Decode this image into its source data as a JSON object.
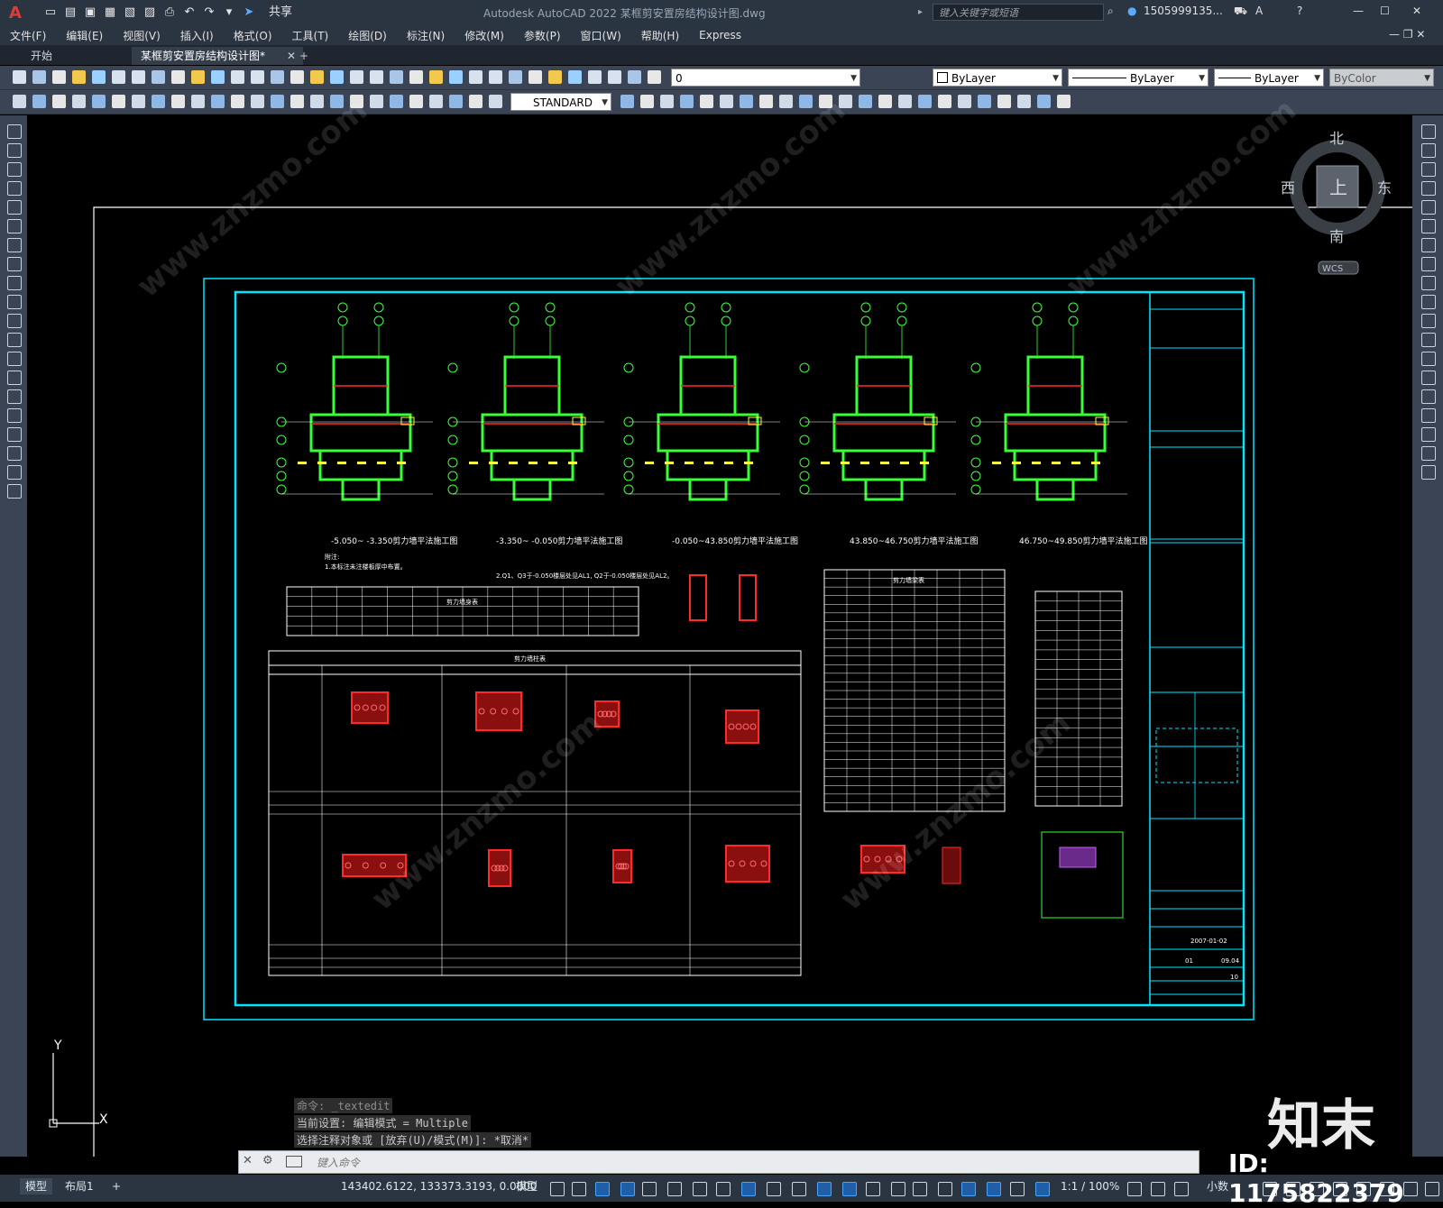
{
  "app": {
    "title_text": "Autodesk AutoCAD 2022    某框剪安置房结构设计图.dwg",
    "logo": "A",
    "share_label": "共享",
    "search_placeholder": "键入关键字或短语",
    "user": "1505999135...",
    "window_controls": [
      "—",
      "☐",
      "✕"
    ]
  },
  "menu": [
    "文件(F)",
    "编辑(E)",
    "视图(V)",
    "插入(I)",
    "格式(O)",
    "工具(T)",
    "绘图(D)",
    "标注(N)",
    "修改(M)",
    "参数(P)",
    "窗口(W)",
    "帮助(H)",
    "Express"
  ],
  "tabs": [
    {
      "label": "开始",
      "active": false
    },
    {
      "label": "某框剪安置房结构设计图*",
      "active": true
    }
  ],
  "toolbar": {
    "layer_value": "0",
    "color_value": "ByLayer",
    "linetype_value": "ByLayer",
    "lineweight_value": "ByLayer",
    "plotstyle_value": "ByColor",
    "textstyle_value": "STANDARD"
  },
  "viewcube": {
    "north": "北",
    "south": "南",
    "east": "东",
    "west": "西",
    "face": "上",
    "wcs": "WCS"
  },
  "ucs": {
    "y": "Y",
    "x": "X"
  },
  "drawing": {
    "plan_titles": [
      "-5.050~ -3.350剪力墙平法施工图",
      "-3.350~ -0.050剪力墙平法施工图",
      "-0.050~43.850剪力墙平法施工图",
      "43.850~46.750剪力墙平法施工图",
      "46.750~49.850剪力墙平法施工图"
    ],
    "notes": [
      "附注:",
      "1.本标注未注楼板厚中布置。",
      "2.Q1、Q3于-0.050楼层处见AL1, Q2于-0.050楼层处见AL2。"
    ],
    "table_headings": [
      "剪力墙身表",
      "剪力墙柱表",
      "剪力墙梁表"
    ],
    "drawing_date": "2007-01-02",
    "drawing_no": "10",
    "version": "01",
    "sheet_code": "09.04"
  },
  "command": {
    "history": [
      "命令: _textedit",
      "当前设置: 编辑模式 = Multiple",
      "选择注释对象或 [放弃(U)/模式(M)]: *取消*"
    ],
    "placeholder": "键入命令"
  },
  "status": {
    "layout_tabs": [
      "模型",
      "布局1"
    ],
    "coords": "143402.6122, 133373.3193, 0.0000",
    "mode": "模型",
    "scale": "1:1 / 100%",
    "units": "小数"
  },
  "watermark": {
    "brand": "知末",
    "id": "ID: 1175822379",
    "site": "www.znzmo.com"
  }
}
